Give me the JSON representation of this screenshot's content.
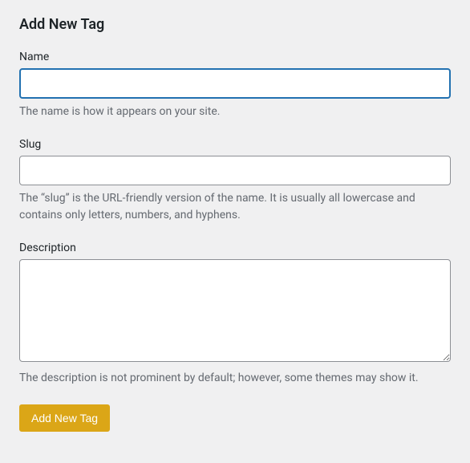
{
  "heading": "Add New Tag",
  "fields": {
    "name": {
      "label": "Name",
      "value": "",
      "help": "The name is how it appears on your site."
    },
    "slug": {
      "label": "Slug",
      "value": "",
      "help": "The “slug” is the URL-friendly version of the name. It is usually all lowercase and contains only letters, numbers, and hyphens."
    },
    "description": {
      "label": "Description",
      "value": "",
      "help": "The description is not prominent by default; however, some themes may show it."
    }
  },
  "submit": {
    "label": "Add New Tag"
  }
}
